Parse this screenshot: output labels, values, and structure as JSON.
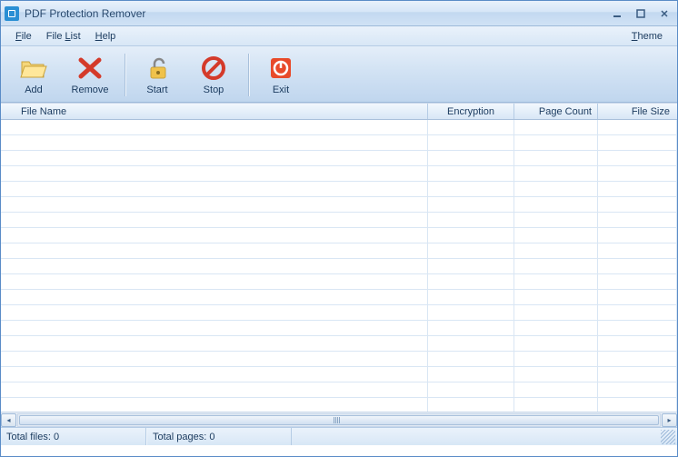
{
  "window": {
    "title": "PDF Protection Remover"
  },
  "menu": {
    "file": "File",
    "file_u": "F",
    "filelist": "File List",
    "filelist_prefix": "File ",
    "filelist_u": "L",
    "filelist_suffix": "ist",
    "help": "Help",
    "help_u": "H",
    "help_suffix": "elp",
    "theme": "Theme",
    "theme_u": "T",
    "theme_suffix": "heme"
  },
  "toolbar": {
    "add": "Add",
    "remove": "Remove",
    "start": "Start",
    "stop": "Stop",
    "exit": "Exit"
  },
  "columns": {
    "filename": "File Name",
    "encryption": "Encryption",
    "pagecount": "Page Count",
    "filesize": "File Size"
  },
  "status": {
    "totalfiles": "Total files: 0",
    "totalpages": "Total pages: 0"
  }
}
